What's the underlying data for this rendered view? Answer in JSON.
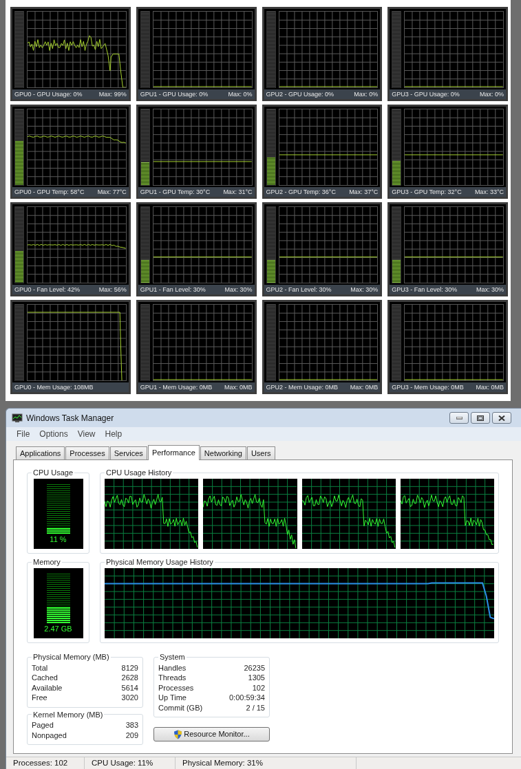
{
  "gauges": [
    {
      "label": "GPU0 - GPU Usage: 0%",
      "max": "Max: 99%",
      "level": 0,
      "kind": "usage-spiky"
    },
    {
      "label": "GPU1 - GPU Usage: 0%",
      "max": "Max: 0%",
      "level": 0,
      "kind": "baseline"
    },
    {
      "label": "GPU2 - GPU Usage: 0%",
      "max": "Max: 0%",
      "level": 0,
      "kind": "baseline"
    },
    {
      "label": "GPU3 - GPU Usage: 0%",
      "max": "Max: 0%",
      "level": 0,
      "kind": "baseline"
    },
    {
      "label": "GPU0 - GPU Temp: 58°C",
      "max": "Max: 77°C",
      "level": 0.58,
      "kind": "temp-easing"
    },
    {
      "label": "GPU1 - GPU Temp: 30°C",
      "max": "Max: 31°C",
      "level": 0.3,
      "kind": "flat-low"
    },
    {
      "label": "GPU2 - GPU Temp: 36°C",
      "max": "Max: 37°C",
      "level": 0.36,
      "kind": "flat-mid"
    },
    {
      "label": "GPU3 - GPU Temp: 32°C",
      "max": "Max: 33°C",
      "level": 0.32,
      "kind": "flat-mid"
    },
    {
      "label": "GPU0 - Fan Level: 42%",
      "max": "Max: 56%",
      "level": 0.42,
      "kind": "fan-easing"
    },
    {
      "label": "GPU1 - Fan Level: 30%",
      "max": "Max: 30%",
      "level": 0.3,
      "kind": "flat-fan"
    },
    {
      "label": "GPU2 - Fan Level: 30%",
      "max": "Max: 30%",
      "level": 0.3,
      "kind": "flat-fan"
    },
    {
      "label": "GPU3 - Fan Level: 30%",
      "max": "Max: 30%",
      "level": 0.3,
      "kind": "flat-fan"
    },
    {
      "label": "GPU0 - Mem Usage: 108MB",
      "level": 0,
      "kind": "mem-plateau"
    },
    {
      "label": "GPU1 - Mem Usage: 0MB",
      "max": "Max: 0MB",
      "level": 0,
      "kind": "baseline"
    },
    {
      "label": "GPU2 - Mem Usage: 0MB",
      "max": "Max: 0MB",
      "level": 0,
      "kind": "baseline"
    },
    {
      "label": "GPU3 - Mem Usage: 0MB",
      "max": "Max: 0MB",
      "level": 0,
      "kind": "baseline"
    }
  ],
  "task_manager": {
    "title": "Windows Task Manager",
    "menu": [
      "File",
      "Options",
      "View",
      "Help"
    ],
    "tabs": [
      {
        "label": "Applications",
        "selected": false
      },
      {
        "label": "Processes",
        "selected": false
      },
      {
        "label": "Services",
        "selected": false
      },
      {
        "label": "Performance",
        "selected": true
      },
      {
        "label": "Networking",
        "selected": false
      },
      {
        "label": "Users",
        "selected": false
      }
    ],
    "cpu_usage": {
      "title": "CPU Usage",
      "reading": "11 %",
      "level": 0.11
    },
    "cpu_history": {
      "title": "CPU Usage History"
    },
    "memory": {
      "title": "Memory",
      "reading": "2.47 GB",
      "level": 0.31
    },
    "memory_history": {
      "title": "Physical Memory Usage History"
    },
    "physical_memory": {
      "title": "Physical Memory (MB)",
      "rows": [
        {
          "label": "Total",
          "value": "8129"
        },
        {
          "label": "Cached",
          "value": "2628"
        },
        {
          "label": "Available",
          "value": "5614"
        },
        {
          "label": "Free",
          "value": "3020"
        }
      ]
    },
    "kernel_memory": {
      "title": "Kernel Memory (MB)",
      "rows": [
        {
          "label": "Paged",
          "value": "383"
        },
        {
          "label": "Nonpaged",
          "value": "209"
        }
      ]
    },
    "system": {
      "title": "System",
      "rows": [
        {
          "label": "Handles",
          "value": "26235"
        },
        {
          "label": "Threads",
          "value": "1305"
        },
        {
          "label": "Processes",
          "value": "102"
        },
        {
          "label": "Up Time",
          "value": "0:00:59:34"
        },
        {
          "label": "Commit (GB)",
          "value": "2 / 15"
        }
      ]
    },
    "resource_button": "Resource Monitor...",
    "status_bar": [
      "Processes: 102",
      "CPU Usage: 11%",
      "Physical Memory: 31%"
    ]
  }
}
